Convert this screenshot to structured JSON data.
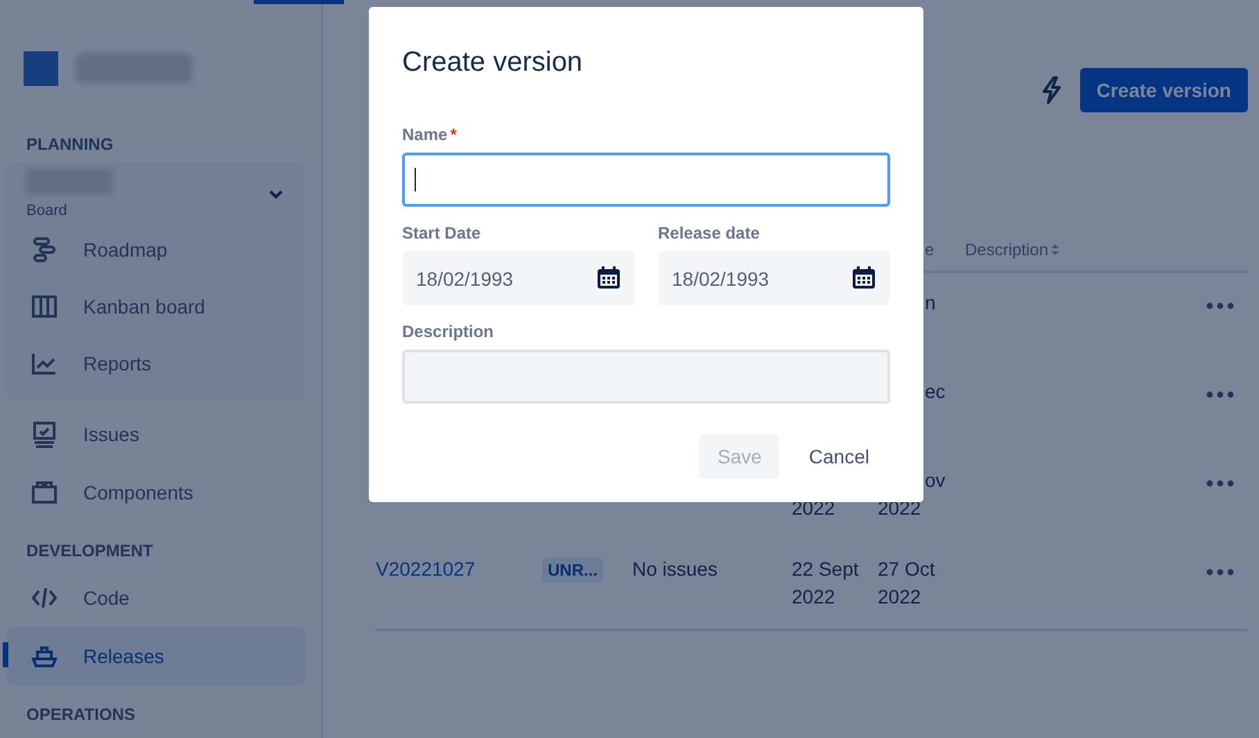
{
  "sidebar": {
    "sections": [
      {
        "heading": "PLANNING",
        "board_caption": "Board",
        "items": [
          {
            "label": "Roadmap",
            "selected": false
          },
          {
            "label": "Kanban board",
            "selected": false
          },
          {
            "label": "Reports",
            "selected": false
          }
        ]
      },
      {
        "items": [
          {
            "label": "Issues",
            "selected": false
          },
          {
            "label": "Components",
            "selected": false
          }
        ]
      },
      {
        "heading": "DEVELOPMENT",
        "items": [
          {
            "label": "Code",
            "selected": false
          },
          {
            "label": "Releases",
            "selected": true
          }
        ]
      },
      {
        "heading": "OPERATIONS"
      }
    ]
  },
  "header": {
    "create_button": "Create version"
  },
  "table": {
    "columns": {
      "release_date": "e",
      "description": "Description"
    },
    "rows": [
      {
        "release_date": {
          "text": "n"
        }
      },
      {
        "release_date": {
          "text": "ec"
        }
      },
      {
        "start_date": {
          "year": "2022"
        },
        "release_date": {
          "text": "ov",
          "year": "2022"
        }
      },
      {
        "version": "V20221027",
        "status": "UNR...",
        "issues": "No issues",
        "start_date": {
          "text": "22 Sept",
          "year": "2022"
        },
        "release_date": {
          "text": "27 Oct",
          "year": "2022"
        }
      }
    ]
  },
  "dialog": {
    "title": "Create version",
    "name": {
      "label": "Name",
      "required_marker": "*",
      "focused": true
    },
    "start_date": {
      "label": "Start Date",
      "value": "18/02/1993"
    },
    "release_date": {
      "label": "Release date",
      "value": "18/02/1993"
    },
    "description": {
      "label": "Description"
    },
    "buttons": [
      {
        "label": "Save",
        "kind": "primary",
        "disabled": true
      },
      {
        "label": "Cancel",
        "kind": "subtle",
        "disabled": false
      }
    ]
  }
}
